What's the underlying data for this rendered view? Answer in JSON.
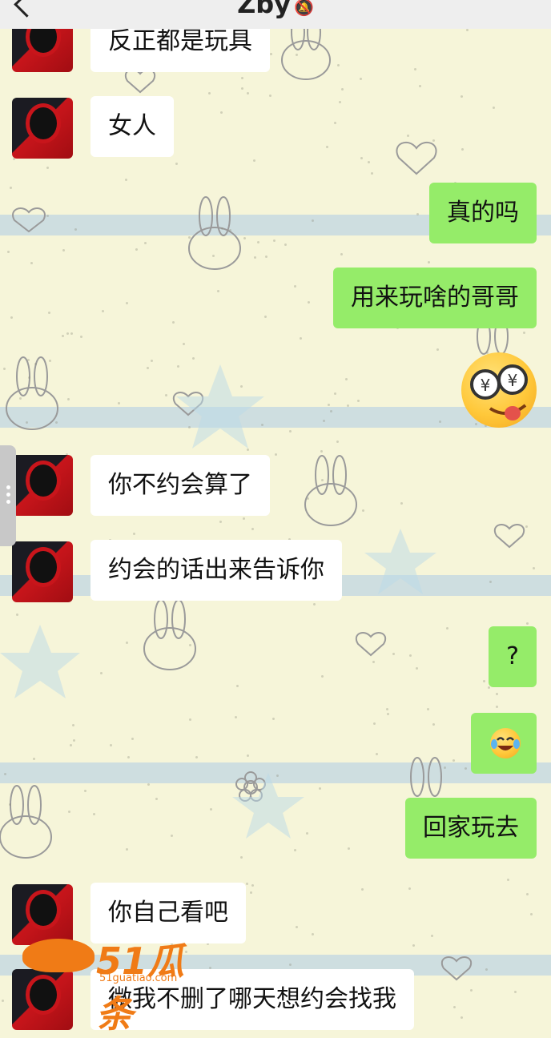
{
  "header": {
    "title": "Zby",
    "back_icon": "chevron-left-icon",
    "mute_icon": "bell-muted-icon"
  },
  "messages": [
    {
      "side": "in",
      "text": "反正都是玩具"
    },
    {
      "side": "in",
      "text": "女人"
    },
    {
      "side": "out",
      "text": "真的吗"
    },
    {
      "side": "out",
      "text": "用来玩啥的哥哥"
    },
    {
      "side": "out",
      "sticker": "money-eyes-tongue-emoji"
    },
    {
      "side": "in",
      "text": "你不约会算了"
    },
    {
      "side": "in",
      "text": "约会的话出来告诉你"
    },
    {
      "side": "out",
      "text": "?"
    },
    {
      "side": "out",
      "sticker": "laughing-tears-emoji"
    },
    {
      "side": "out",
      "text": "回家玩去"
    },
    {
      "side": "in",
      "text": "你自己看吧"
    },
    {
      "side": "in",
      "text": "微我不删了哪天想约会找我"
    }
  ],
  "watermark": {
    "brand": "51瓜条",
    "site": "51guatiao.com"
  },
  "colors": {
    "outgoing_bubble": "#95ec69",
    "incoming_bubble": "#ffffff",
    "watermark": "#f07b16"
  }
}
